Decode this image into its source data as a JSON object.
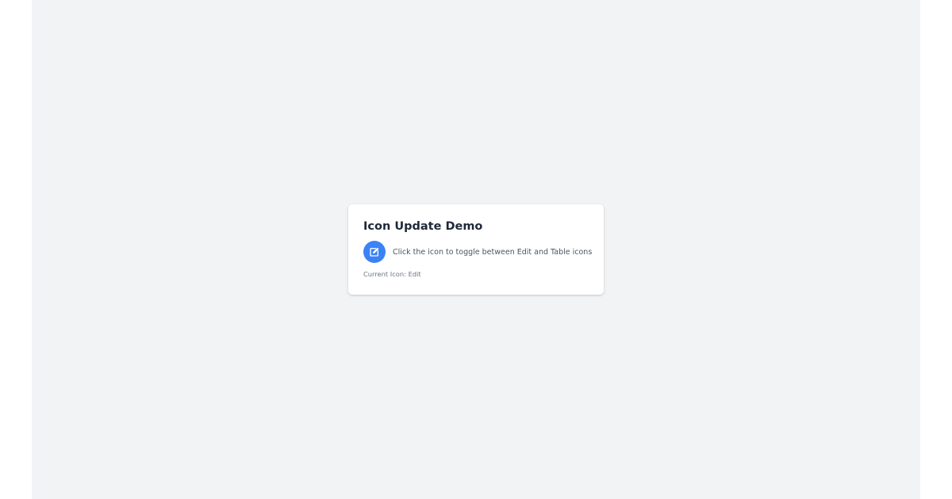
{
  "card": {
    "title": "Icon Update Demo",
    "instruction": "Click the icon to toggle between Edit and Table icons",
    "status_label": "Current Icon:",
    "status_value": "Edit"
  },
  "icon": {
    "name": "edit-icon",
    "background": "#3b82f6",
    "foreground": "#ffffff"
  }
}
